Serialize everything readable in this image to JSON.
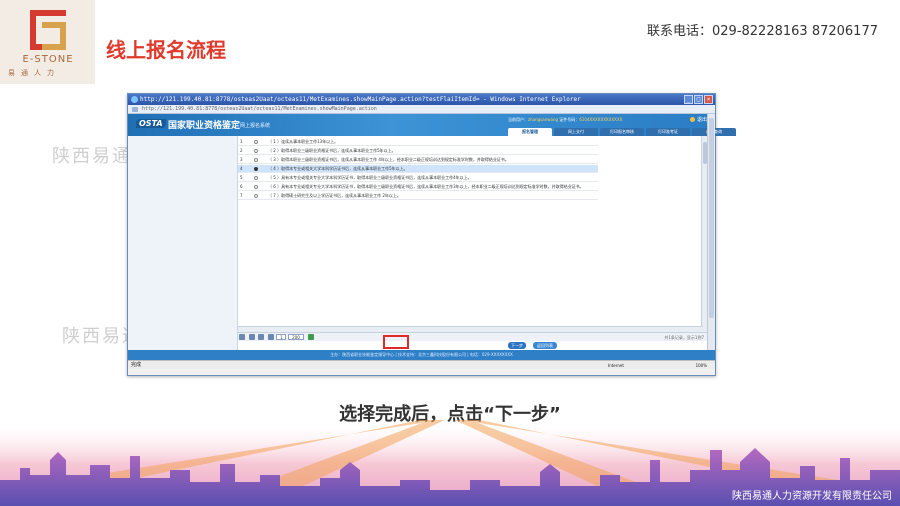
{
  "slide": {
    "logo_en": "E-STONE",
    "logo_cn": "易通人力",
    "title": "线上报名流程",
    "contact": "联系电话：029-82228163 87206177",
    "watermark": "陕西易通人力资源开发有限责任公司",
    "instruction": "选择完成后，点击“下一步”",
    "company": "陕西易通人力资源开发有限责任公司"
  },
  "browser": {
    "title": "http://121.199.40.81:8778/osteas2Uaat/octeas11/MetExamines.showMainPage.action?testFlaiItemId=  - Windows Internet Explorer",
    "address": "http://121.199.40.81:8778/osteas2Uaat/octeas11/MetExamines.showMainPage.action",
    "status": "完成",
    "zone": "Internet",
    "zoom": "100%"
  },
  "site": {
    "logo": "OSTA",
    "name": "国家职业资格鉴定",
    "subtitle": "网上报名系统",
    "user_label": "当前用户：",
    "user_value": "zhangsanwang",
    "id_label": "  证件号码：",
    "id_value": "6104XXXXXXXXXXXX",
    "exit": "退出",
    "tabs": [
      "报名管理",
      "网上支付",
      "打印报名审核",
      "打印准考证",
      "成绩查询"
    ],
    "active_tab": 0,
    "footer": "主办：陕西省职业技能鉴定指导中心 | 技术支持：北京三鑫科技股份有限公司 | 电话：029-XXXXXXXX"
  },
  "grid": {
    "rows": [
      {
        "no": "1",
        "text": "（ 1 ）连续从事本职业工作13年以上。",
        "selected": false
      },
      {
        "no": "2",
        "text": "（ 2 ）取得本职业三级职业资格证书后，连续从事本职业工作5年以上。",
        "selected": false
      },
      {
        "no": "3",
        "text": "（ 3 ）取得本职业三级职业资格证书后，连续从事本职业工作 4年以上，经本职业二级正规培训达到规定标准学时数，并取得结业证书。",
        "selected": false
      },
      {
        "no": "4",
        "text": "（ 4 ）取得本专业或相关大学本科学历证书后，连续从事本职业工作5年以上。",
        "selected": true
      },
      {
        "no": "5",
        "text": "（ 5 ）具有本专业或相关专业大学本科学历证书，取得本职业三级职业资格证书后，连续从事本职业工作4年以上。",
        "selected": false
      },
      {
        "no": "6",
        "text": "（ 6 ）具有本专业或相关专业大学本科学历证书，取得本职业三级职业资格证书后，连续从事本职业工作3年以上，经本职业二级正规培训达到规定标准学时数，并取得结业证书。",
        "selected": false
      },
      {
        "no": "7",
        "text": "（ 7 ）取得硕士研究生及以上学历证书后，连续从事本职业工作 2年以上。",
        "selected": false
      }
    ]
  },
  "pager": {
    "page": "1",
    "page_size": "200",
    "status": "共1条记录，显示1到7"
  },
  "buttons": {
    "next": "下一步",
    "back": "返回列表"
  }
}
